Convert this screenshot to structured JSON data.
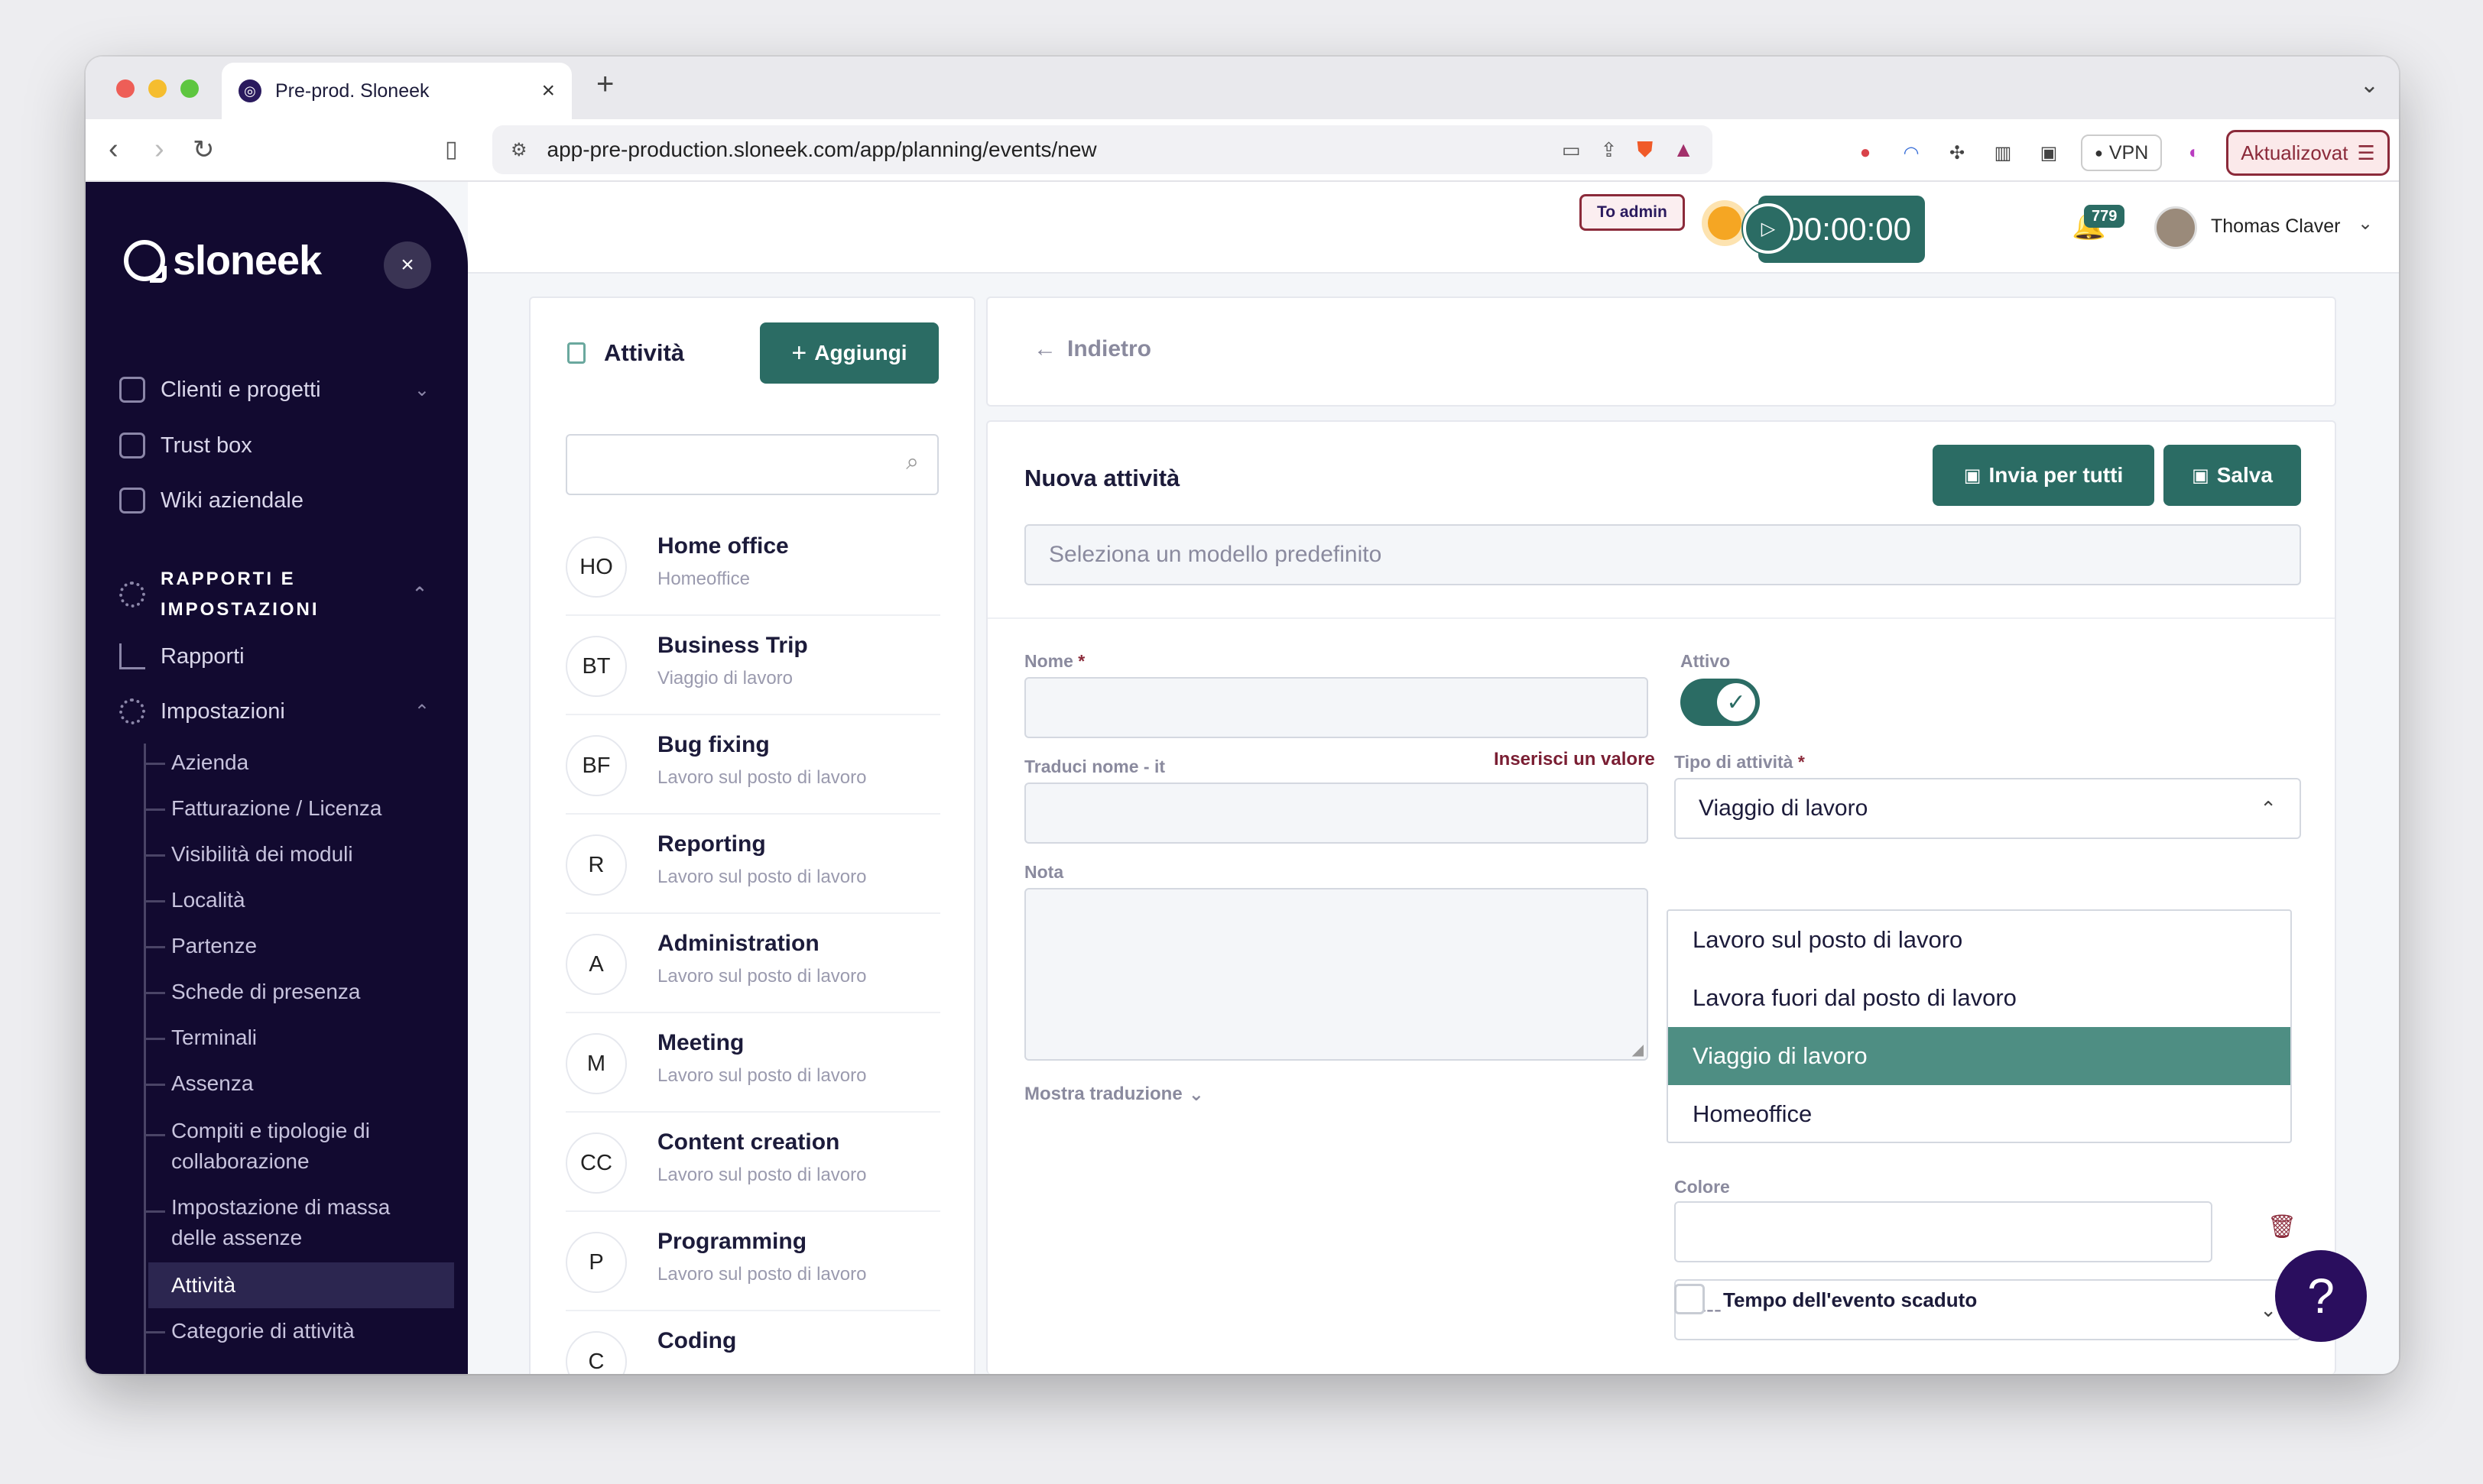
{
  "browser": {
    "tab_title": "Pre-prod. Sloneek",
    "url": "app-pre-production.sloneek.com/app/planning/events/new",
    "vpn_label": "VPN",
    "update_label": "Aktualizovat"
  },
  "sidebar": {
    "brand": "sloneek",
    "top_items": [
      {
        "label": "Clienti e progetti",
        "icon": "clients-icon"
      },
      {
        "label": "Trust box",
        "icon": "trust-box-icon"
      },
      {
        "label": "Wiki aziendale",
        "icon": "wiki-icon"
      }
    ],
    "section_title_1": "RAPPORTI E",
    "section_title_2": "IMPOSTAZIONI",
    "reports_label": "Rapporti",
    "settings_label": "Impostazioni",
    "settings_items": [
      "Azienda",
      "Fatturazione / Licenza",
      "Visibilità dei moduli",
      "Località",
      "Partenze",
      "Schede di presenza",
      "Terminali",
      "Assenza",
      "Compiti e tipologie di collaborazione",
      "Impostazione di massa delle assenze",
      "Attività",
      "Categorie di attività"
    ]
  },
  "topbar": {
    "to_admin": "To admin",
    "timer": "00:00:00",
    "notifications": "779",
    "user_name": "Thomas Claver"
  },
  "list_panel": {
    "title": "Attività",
    "add_label": "Aggiungi",
    "search_placeholder": "",
    "items": [
      {
        "initials": "HO",
        "name": "Home office",
        "type": "Homeoffice"
      },
      {
        "initials": "BT",
        "name": "Business Trip",
        "type": "Viaggio di lavoro"
      },
      {
        "initials": "BF",
        "name": "Bug fixing",
        "type": "Lavoro sul posto di lavoro"
      },
      {
        "initials": "R",
        "name": "Reporting",
        "type": "Lavoro sul posto di lavoro"
      },
      {
        "initials": "A",
        "name": "Administration",
        "type": "Lavoro sul posto di lavoro"
      },
      {
        "initials": "M",
        "name": "Meeting",
        "type": "Lavoro sul posto di lavoro"
      },
      {
        "initials": "CC",
        "name": "Content creation",
        "type": "Lavoro sul posto di lavoro"
      },
      {
        "initials": "P",
        "name": "Programming",
        "type": "Lavoro sul posto di lavoro"
      },
      {
        "initials": "C",
        "name": "Coding",
        "type": ""
      }
    ]
  },
  "form": {
    "back_label": "Indietro",
    "title": "Nuova attività",
    "send_all_label": "Invia per tutti",
    "save_label": "Salva",
    "template_placeholder": "Seleziona un modello predefinito",
    "name_label": "Nome",
    "required_mark": "*",
    "name_value": "",
    "name_error": "Inserisci un valore",
    "translate_label": "Traduci nome - it",
    "translate_value": "",
    "note_label": "Nota",
    "note_value": "",
    "show_translation": "Mostra traduzione",
    "active_label": "Attivo",
    "active_on": true,
    "type_label": "Tipo di attività",
    "type_value": "Viaggio di lavoro",
    "type_options": [
      "Lavoro sul posto di lavoro",
      "Lavora fuori dal posto di lavoro",
      "Viaggio di lavoro",
      "Homeoffice"
    ],
    "currency_value": "---",
    "color_label": "Colore",
    "color_value": "",
    "expired_label": "Tempo dell'evento scaduto",
    "help_label": "?"
  },
  "colors": {
    "primary": "#2b6c64",
    "sidebar": "#120a30",
    "accent_red": "#8b2a3a"
  }
}
